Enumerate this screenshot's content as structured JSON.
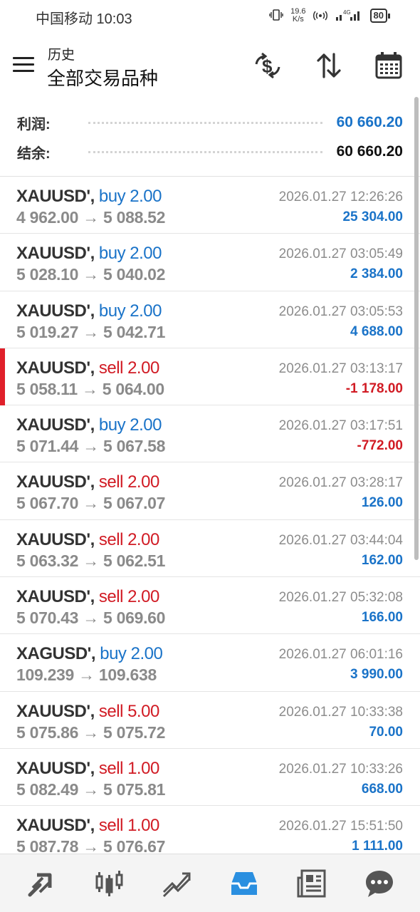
{
  "status_bar": {
    "carrier_time": "中国移动 10:03",
    "speed_value": "19.6",
    "speed_unit": "K/s",
    "battery": "80"
  },
  "header": {
    "subtitle": "历史",
    "title": "全部交易品种"
  },
  "summary": {
    "profit_label": "利润:",
    "profit_value": "60 660.20",
    "balance_label": "结余:",
    "balance_value": "60 660.20"
  },
  "colors": {
    "buy": "#1a73c8",
    "sell": "#d11b24",
    "selected_marker": "#e0202a"
  },
  "trades": [
    {
      "symbol": "XAUUSD'",
      "side": "buy 2.00",
      "side_type": "buy",
      "prices": "4 962.00 → 5 088.52",
      "time": "2026.01.27 12:26:26",
      "profit": "25 304.00",
      "profit_type": "pos"
    },
    {
      "symbol": "XAUUSD'",
      "side": "buy 2.00",
      "side_type": "buy",
      "prices": "5 028.10 → 5 040.02",
      "time": "2026.01.27 03:05:49",
      "profit": "2 384.00",
      "profit_type": "pos"
    },
    {
      "symbol": "XAUUSD'",
      "side": "buy 2.00",
      "side_type": "buy",
      "prices": "5 019.27 → 5 042.71",
      "time": "2026.01.27 03:05:53",
      "profit": "4 688.00",
      "profit_type": "pos"
    },
    {
      "symbol": "XAUUSD'",
      "side": "sell 2.00",
      "side_type": "sell",
      "prices": "5 058.11 → 5 064.00",
      "time": "2026.01.27 03:13:17",
      "profit": "-1 178.00",
      "profit_type": "neg",
      "selected": true
    },
    {
      "symbol": "XAUUSD'",
      "side": "buy 2.00",
      "side_type": "buy",
      "prices": "5 071.44 → 5 067.58",
      "time": "2026.01.27 03:17:51",
      "profit": "-772.00",
      "profit_type": "neg"
    },
    {
      "symbol": "XAUUSD'",
      "side": "sell 2.00",
      "side_type": "sell",
      "prices": "5 067.70 → 5 067.07",
      "time": "2026.01.27 03:28:17",
      "profit": "126.00",
      "profit_type": "pos"
    },
    {
      "symbol": "XAUUSD'",
      "side": "sell 2.00",
      "side_type": "sell",
      "prices": "5 063.32 → 5 062.51",
      "time": "2026.01.27 03:44:04",
      "profit": "162.00",
      "profit_type": "pos"
    },
    {
      "symbol": "XAUUSD'",
      "side": "sell 2.00",
      "side_type": "sell",
      "prices": "5 070.43 → 5 069.60",
      "time": "2026.01.27 05:32:08",
      "profit": "166.00",
      "profit_type": "pos"
    },
    {
      "symbol": "XAGUSD'",
      "side": "buy 2.00",
      "side_type": "buy",
      "prices": "109.239 → 109.638",
      "time": "2026.01.27 06:01:16",
      "profit": "3 990.00",
      "profit_type": "pos"
    },
    {
      "symbol": "XAUUSD'",
      "side": "sell 5.00",
      "side_type": "sell",
      "prices": "5 075.86 → 5 075.72",
      "time": "2026.01.27 10:33:38",
      "profit": "70.00",
      "profit_type": "pos"
    },
    {
      "symbol": "XAUUSD'",
      "side": "sell 1.00",
      "side_type": "sell",
      "prices": "5 082.49 → 5 075.81",
      "time": "2026.01.27 10:33:26",
      "profit": "668.00",
      "profit_type": "pos"
    },
    {
      "symbol": "XAUUSD'",
      "side": "sell 1.00",
      "side_type": "sell",
      "prices": "5 087.78 → 5 076.67",
      "time": "2026.01.27 15:51:50",
      "profit": "1 111.00",
      "profit_type": "pos"
    }
  ],
  "icons": {
    "header": [
      "currency-exchange-icon",
      "sort-icon",
      "calendar-icon"
    ],
    "bottom_nav": [
      "quotes-icon",
      "chart-icon",
      "trade-icon",
      "history-icon",
      "news-icon",
      "messages-icon"
    ],
    "active_tab": "history-icon"
  }
}
